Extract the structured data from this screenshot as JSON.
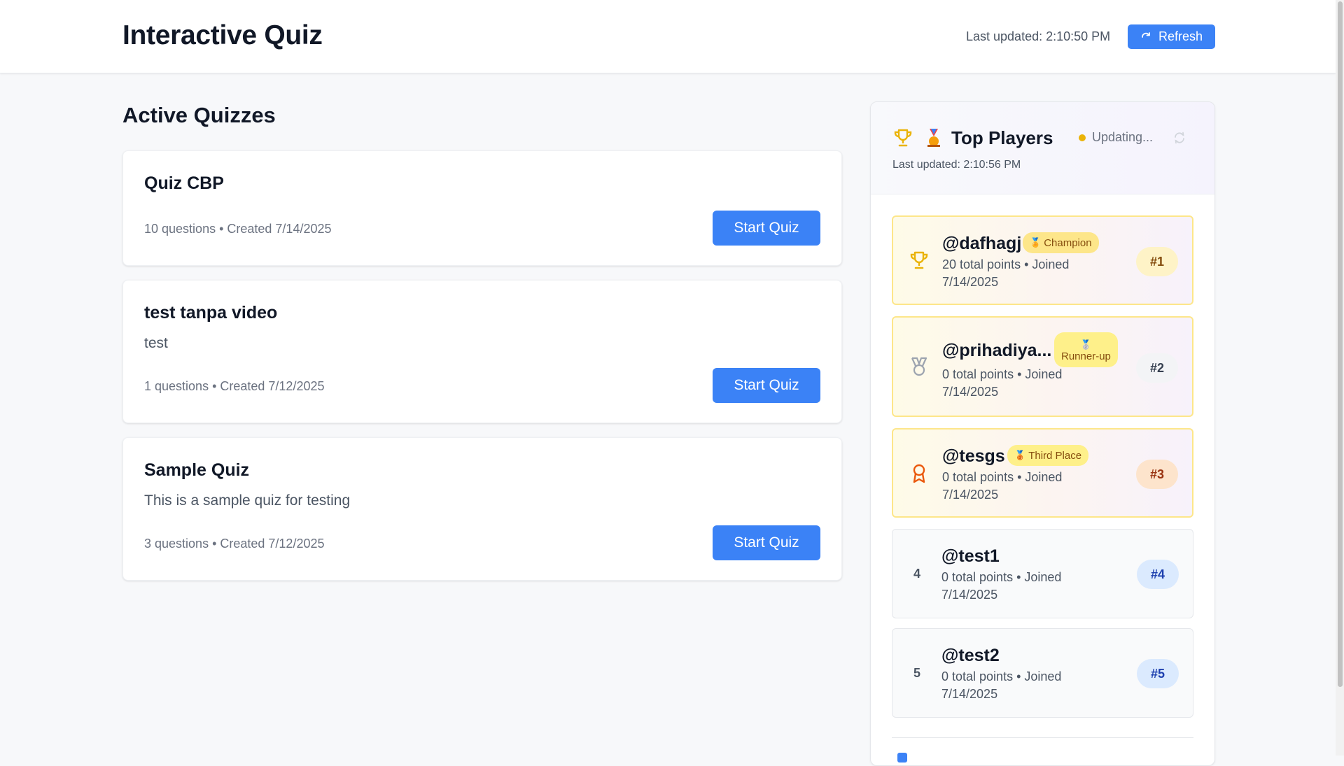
{
  "header": {
    "title": "Interactive Quiz",
    "last_updated": "Last updated: 2:10:50 PM",
    "refresh_label": "Refresh"
  },
  "main": {
    "section_title": "Active Quizzes",
    "quizzes": [
      {
        "title": "Quiz CBP",
        "description": "",
        "meta": "10 questions • Created 7/14/2025",
        "button": "Start Quiz"
      },
      {
        "title": "test tanpa video",
        "description": "test",
        "meta": "1 questions • Created 7/12/2025",
        "button": "Start Quiz"
      },
      {
        "title": "Sample Quiz",
        "description": "This is a sample quiz for testing",
        "meta": "3 questions • Created 7/12/2025",
        "button": "Start Quiz"
      }
    ]
  },
  "leaderboard": {
    "title": "Top Players",
    "status": "Updating...",
    "last_updated": "Last updated: 2:10:56 PM",
    "players": [
      {
        "name": "@dafhagj",
        "badge": "Champion",
        "info": "20 total points  • Joined 7/14/2025",
        "rank_label": "#1",
        "rank_num": "1"
      },
      {
        "name": "@prihadiya...",
        "badge": "Runner-up",
        "info": "0 total points  • Joined 7/14/2025",
        "rank_label": "#2",
        "rank_num": "2"
      },
      {
        "name": "@tesgs",
        "badge": "Third Place",
        "info": "0 total points  • Joined 7/14/2025",
        "rank_label": "#3",
        "rank_num": "3"
      },
      {
        "name": "@test1",
        "badge": "",
        "info": "0 total points  • Joined 7/14/2025",
        "rank_label": "#4",
        "rank_num": "4"
      },
      {
        "name": "@test2",
        "badge": "",
        "info": "0 total points  • Joined 7/14/2025",
        "rank_label": "#5",
        "rank_num": "5"
      }
    ]
  },
  "colors": {
    "primary": "#3b82f6",
    "gold": "#eab308",
    "status_dot": "#eab308"
  },
  "icons": {
    "refresh": "refresh-icon",
    "trophy": "trophy-icon",
    "medal": "medal-icon",
    "sync": "sync-icon",
    "award": "award-icon"
  }
}
